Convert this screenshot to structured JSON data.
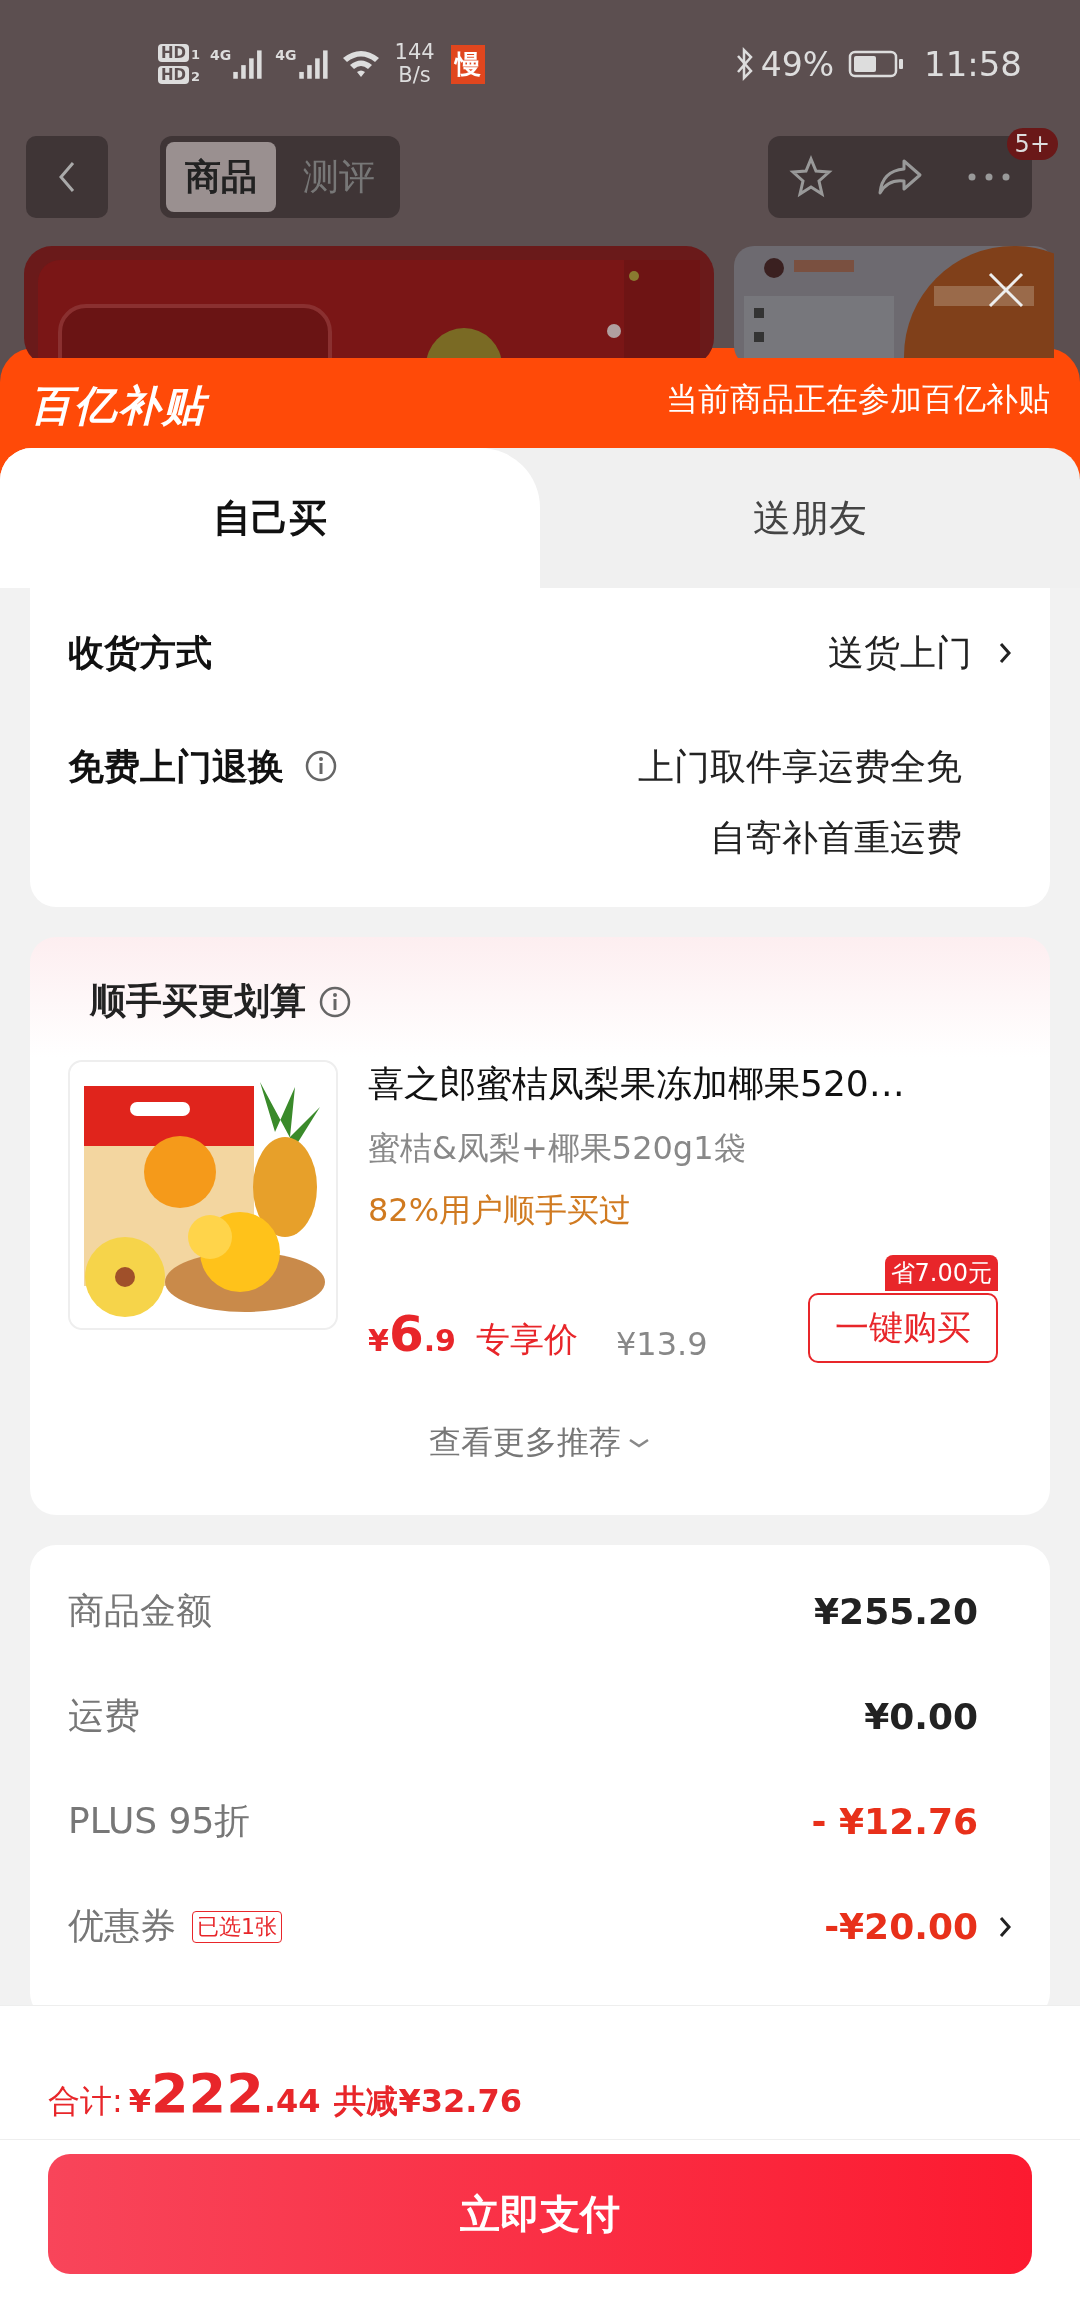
{
  "status_bar": {
    "sims": [
      {
        "label": "HD",
        "slot": "1"
      },
      {
        "label": "HD",
        "slot": "2"
      }
    ],
    "networks": [
      "4G",
      "4G"
    ],
    "speed_value": "144",
    "speed_unit": "B/s",
    "app_badge": "慢",
    "battery": "49%",
    "time": "11:58"
  },
  "header": {
    "tabs": [
      {
        "label": "商品",
        "selected": true
      },
      {
        "label": "测评",
        "selected": false
      }
    ],
    "badge": "5+"
  },
  "banner": {
    "logo": "百亿补贴",
    "notice": "当前商品正在参加百亿补贴"
  },
  "mode_tabs": [
    {
      "label": "自己买",
      "selected": true
    },
    {
      "label": "送朋友",
      "selected": false
    }
  ],
  "delivery": {
    "label": "收货方式",
    "value": "送货上门"
  },
  "returns": {
    "label": "免费上门退换",
    "lines": [
      "上门取件享运费全免",
      "自寄补首重运费"
    ]
  },
  "addon": {
    "title": "顺手买更划算",
    "product": {
      "name": "喜之郎蜜桔凤梨果冻加椰果520…",
      "spec": "蜜桔&凤梨+椰果520g1袋",
      "social": "82%用户顺手买过",
      "price_symbol": "¥",
      "price_int": "6",
      "price_dec": ".9",
      "price_label": "专享价",
      "original_price": "¥13.9",
      "saving": "省7.00元",
      "button": "一键购买"
    },
    "more": "查看更多推荐"
  },
  "summary": [
    {
      "kind": "plain",
      "label": "商品金额",
      "value": "¥255.20"
    },
    {
      "kind": "plain",
      "label": "运费",
      "value": "¥0.00"
    },
    {
      "kind": "discount",
      "label": "PLUS 95折",
      "value": "- ¥12.76"
    },
    {
      "kind": "coupon",
      "label": "优惠券",
      "tag": "已选1张",
      "value": "-¥20.00"
    }
  ],
  "footer": {
    "total_label": "合计:",
    "symbol": "¥",
    "int": "222",
    "dec": ".44",
    "reduction": "共减¥32.76",
    "pay_button": "立即支付"
  }
}
